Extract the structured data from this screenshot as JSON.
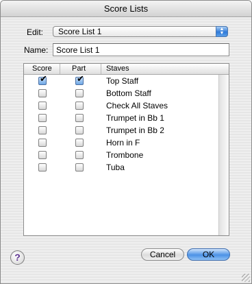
{
  "window": {
    "title": "Score Lists"
  },
  "edit": {
    "label": "Edit:",
    "value": "Score List 1"
  },
  "name": {
    "label": "Name:",
    "value": "Score List 1"
  },
  "table": {
    "headers": [
      "Score",
      "Part",
      "Staves"
    ],
    "rows": [
      {
        "score": true,
        "part": true,
        "staff": "Top Staff"
      },
      {
        "score": false,
        "part": false,
        "staff": "Bottom Staff"
      },
      {
        "score": false,
        "part": false,
        "staff": "Check All Staves"
      },
      {
        "score": false,
        "part": false,
        "staff": "Trumpet in Bb 1"
      },
      {
        "score": false,
        "part": false,
        "staff": "Trumpet in Bb 2"
      },
      {
        "score": false,
        "part": false,
        "staff": "Horn in F"
      },
      {
        "score": false,
        "part": false,
        "staff": "Trombone"
      },
      {
        "score": false,
        "part": false,
        "staff": "Tuba"
      }
    ]
  },
  "buttons": {
    "cancel": "Cancel",
    "ok": "OK",
    "help": "?"
  },
  "colors": {
    "default_button": "#4b92e6",
    "checkbox_checked": "#6fa7e6"
  }
}
